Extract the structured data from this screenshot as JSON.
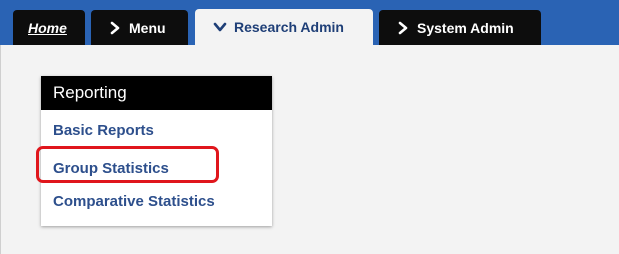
{
  "tabs": {
    "home": "Home",
    "menu": "Menu",
    "research_admin": "Research Admin",
    "system_admin": "System Admin"
  },
  "panel": {
    "title": "Reporting",
    "items": [
      "Basic Reports",
      "Group Statistics",
      "Comparative Statistics"
    ]
  },
  "colors": {
    "tab_bar": "#2a63b4",
    "tab_dark": "#0d0d0d",
    "link": "#2d4f8c",
    "highlight": "#e0161c"
  },
  "icons": {
    "menu": "chevron-right-icon",
    "research_admin": "chevron-down-icon",
    "system_admin": "chevron-right-icon"
  }
}
